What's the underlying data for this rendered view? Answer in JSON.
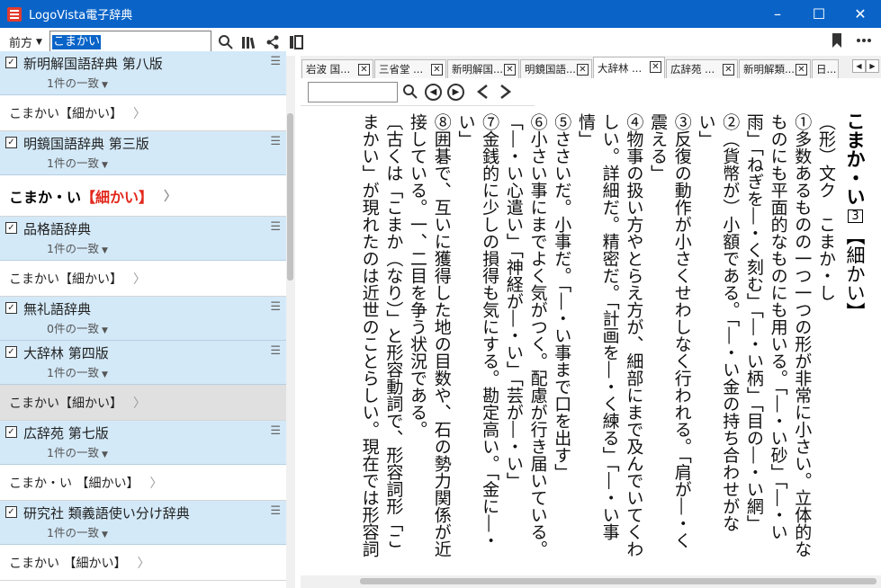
{
  "window": {
    "title": "LogoVista電子辞典",
    "minimize": "–",
    "maximize": "☐",
    "close": "✕"
  },
  "toolbar": {
    "direction": "前方",
    "search_value": "こまかい"
  },
  "dictionaries": [
    {
      "name": "新明解国語辞典 第八版",
      "count": "1件の一致",
      "result": "こまかい【細かい】",
      "result_style": "normal"
    },
    {
      "name": "明鏡国語辞典 第三版",
      "count": "1件の一致",
      "result_pre": "こまか・い",
      "result_br": "【細かい】",
      "result_style": "bold"
    },
    {
      "name": "品格語辞典",
      "count": "1件の一致",
      "result": "こまかい【細かい】",
      "result_style": "normal"
    },
    {
      "name": "無礼語辞典",
      "count": "0件の一致",
      "result": "",
      "result_style": "none"
    },
    {
      "name": "大辞林 第四版",
      "count": "1件の一致",
      "result": "こまかい【細かい】",
      "result_style": "selected"
    },
    {
      "name": "広辞苑 第七版",
      "count": "1件の一致",
      "result": "こまか・い 【細かい】",
      "result_style": "normal"
    },
    {
      "name": "研究社 類義語使い分け辞典",
      "count": "1件の一致",
      "result": "こまかい 【細かい】",
      "result_style": "normal"
    }
  ],
  "tabs": [
    {
      "label": "岩波 国..."
    },
    {
      "label": "三省堂 ..."
    },
    {
      "label": "新明解国..."
    },
    {
      "label": "明鏡国語..."
    },
    {
      "label": "大辞林 ..."
    },
    {
      "label": "広辞苑 ..."
    },
    {
      "label": "新明解類..."
    },
    {
      "label": "日..."
    }
  ],
  "entry": {
    "headword": "こまか・い",
    "accent": "3",
    "kanji": "【細かい】",
    "columns": [
      "（形）文ク　こまか・し",
      "①多数あるものの一つ一つの形が非常に小さい。立体的な",
      "ものにも平面的なものにも用いる。「―・い砂」「―・い",
      "雨」「ねぎを―・く刻む」「―・い柄」「目の―・い網」",
      "②（貨幣が）小額である。「―・い金の持ち合わせがな",
      "い」",
      "③反復の動作が小さくせわしなく行われる。「肩が―・く",
      "震える」",
      "④物事の扱い方やとらえ方が、細部にまで及んでいてくわ",
      "しい。詳細だ。精密だ。「計画を―・く練る」「―・い事",
      "情」",
      "⑤ささいだ。小事だ。「―・い事まで口を出す」",
      "⑥小さい事にまでよく気がつく。配慮が行き届いている。",
      "「―・い心遣い」「神経が―・い」「芸が―・い」",
      "⑦金銭的に少しの損得も気にする。勘定高い。「金に―・",
      "い」",
      "⑧囲碁で、互いに獲得した地の目数や、石の勢力関係が近",
      "接している。一、二目を争う状況である。",
      "〔古くは「こまか（なり）」と形容動詞で、形容詞形「こ",
      "まかい」が現れたのは近世のことらしい。現在では形容詞"
    ]
  },
  "colors": {
    "titlebar": "#0a64c8",
    "dict_header": "#d3e9f8",
    "accent_red": "#e2271c"
  }
}
